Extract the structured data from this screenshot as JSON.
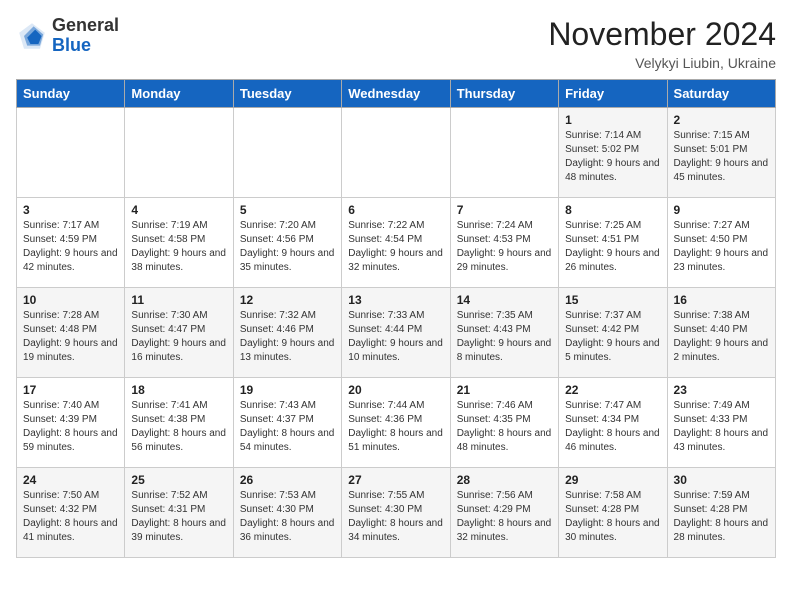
{
  "logo": {
    "general": "General",
    "blue": "Blue"
  },
  "title": "November 2024",
  "location": "Velykyi Liubin, Ukraine",
  "days_of_week": [
    "Sunday",
    "Monday",
    "Tuesday",
    "Wednesday",
    "Thursday",
    "Friday",
    "Saturday"
  ],
  "weeks": [
    [
      {
        "day": "",
        "info": ""
      },
      {
        "day": "",
        "info": ""
      },
      {
        "day": "",
        "info": ""
      },
      {
        "day": "",
        "info": ""
      },
      {
        "day": "",
        "info": ""
      },
      {
        "day": "1",
        "info": "Sunrise: 7:14 AM\nSunset: 5:02 PM\nDaylight: 9 hours and 48 minutes."
      },
      {
        "day": "2",
        "info": "Sunrise: 7:15 AM\nSunset: 5:01 PM\nDaylight: 9 hours and 45 minutes."
      }
    ],
    [
      {
        "day": "3",
        "info": "Sunrise: 7:17 AM\nSunset: 4:59 PM\nDaylight: 9 hours and 42 minutes."
      },
      {
        "day": "4",
        "info": "Sunrise: 7:19 AM\nSunset: 4:58 PM\nDaylight: 9 hours and 38 minutes."
      },
      {
        "day": "5",
        "info": "Sunrise: 7:20 AM\nSunset: 4:56 PM\nDaylight: 9 hours and 35 minutes."
      },
      {
        "day": "6",
        "info": "Sunrise: 7:22 AM\nSunset: 4:54 PM\nDaylight: 9 hours and 32 minutes."
      },
      {
        "day": "7",
        "info": "Sunrise: 7:24 AM\nSunset: 4:53 PM\nDaylight: 9 hours and 29 minutes."
      },
      {
        "day": "8",
        "info": "Sunrise: 7:25 AM\nSunset: 4:51 PM\nDaylight: 9 hours and 26 minutes."
      },
      {
        "day": "9",
        "info": "Sunrise: 7:27 AM\nSunset: 4:50 PM\nDaylight: 9 hours and 23 minutes."
      }
    ],
    [
      {
        "day": "10",
        "info": "Sunrise: 7:28 AM\nSunset: 4:48 PM\nDaylight: 9 hours and 19 minutes."
      },
      {
        "day": "11",
        "info": "Sunrise: 7:30 AM\nSunset: 4:47 PM\nDaylight: 9 hours and 16 minutes."
      },
      {
        "day": "12",
        "info": "Sunrise: 7:32 AM\nSunset: 4:46 PM\nDaylight: 9 hours and 13 minutes."
      },
      {
        "day": "13",
        "info": "Sunrise: 7:33 AM\nSunset: 4:44 PM\nDaylight: 9 hours and 10 minutes."
      },
      {
        "day": "14",
        "info": "Sunrise: 7:35 AM\nSunset: 4:43 PM\nDaylight: 9 hours and 8 minutes."
      },
      {
        "day": "15",
        "info": "Sunrise: 7:37 AM\nSunset: 4:42 PM\nDaylight: 9 hours and 5 minutes."
      },
      {
        "day": "16",
        "info": "Sunrise: 7:38 AM\nSunset: 4:40 PM\nDaylight: 9 hours and 2 minutes."
      }
    ],
    [
      {
        "day": "17",
        "info": "Sunrise: 7:40 AM\nSunset: 4:39 PM\nDaylight: 8 hours and 59 minutes."
      },
      {
        "day": "18",
        "info": "Sunrise: 7:41 AM\nSunset: 4:38 PM\nDaylight: 8 hours and 56 minutes."
      },
      {
        "day": "19",
        "info": "Sunrise: 7:43 AM\nSunset: 4:37 PM\nDaylight: 8 hours and 54 minutes."
      },
      {
        "day": "20",
        "info": "Sunrise: 7:44 AM\nSunset: 4:36 PM\nDaylight: 8 hours and 51 minutes."
      },
      {
        "day": "21",
        "info": "Sunrise: 7:46 AM\nSunset: 4:35 PM\nDaylight: 8 hours and 48 minutes."
      },
      {
        "day": "22",
        "info": "Sunrise: 7:47 AM\nSunset: 4:34 PM\nDaylight: 8 hours and 46 minutes."
      },
      {
        "day": "23",
        "info": "Sunrise: 7:49 AM\nSunset: 4:33 PM\nDaylight: 8 hours and 43 minutes."
      }
    ],
    [
      {
        "day": "24",
        "info": "Sunrise: 7:50 AM\nSunset: 4:32 PM\nDaylight: 8 hours and 41 minutes."
      },
      {
        "day": "25",
        "info": "Sunrise: 7:52 AM\nSunset: 4:31 PM\nDaylight: 8 hours and 39 minutes."
      },
      {
        "day": "26",
        "info": "Sunrise: 7:53 AM\nSunset: 4:30 PM\nDaylight: 8 hours and 36 minutes."
      },
      {
        "day": "27",
        "info": "Sunrise: 7:55 AM\nSunset: 4:30 PM\nDaylight: 8 hours and 34 minutes."
      },
      {
        "day": "28",
        "info": "Sunrise: 7:56 AM\nSunset: 4:29 PM\nDaylight: 8 hours and 32 minutes."
      },
      {
        "day": "29",
        "info": "Sunrise: 7:58 AM\nSunset: 4:28 PM\nDaylight: 8 hours and 30 minutes."
      },
      {
        "day": "30",
        "info": "Sunrise: 7:59 AM\nSunset: 4:28 PM\nDaylight: 8 hours and 28 minutes."
      }
    ]
  ]
}
